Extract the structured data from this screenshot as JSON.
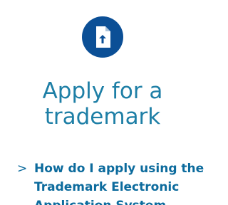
{
  "icon": {
    "name": "file-upload-icon"
  },
  "title": {
    "line1": "Apply for a",
    "line2": "trademark"
  },
  "links": [
    {
      "chevron": ">",
      "text": "How do I apply using the Trademark Electronic Application System"
    }
  ],
  "colors": {
    "icon_background": "#0b4f96",
    "title": "#1e7fa6",
    "link": "#0c6b9d"
  }
}
